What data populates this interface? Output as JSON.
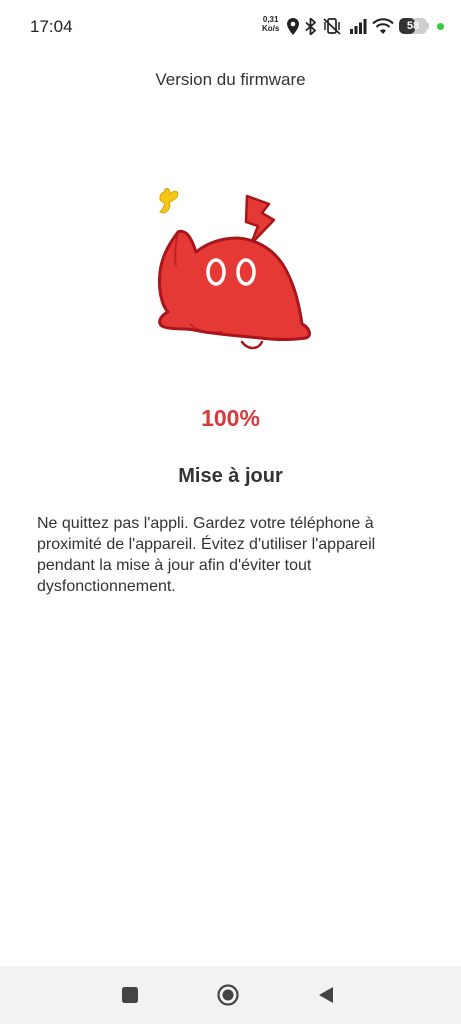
{
  "status_bar": {
    "time": "17:04",
    "net_speed_value": "0,31",
    "net_speed_unit": "Ko/s",
    "battery_level": "58",
    "icons": [
      "location-icon",
      "bluetooth-icon",
      "vibrate-icon",
      "signal-icon",
      "wifi-icon",
      "battery-icon",
      "green-dot-indicator"
    ]
  },
  "header": {
    "title": "Version du firmware"
  },
  "progress": {
    "value_label": "100%",
    "color": "#d63a3a"
  },
  "main": {
    "heading": "Mise à jour",
    "description": "Ne quittez pas l'appli. Gardez votre téléphone à proximité de l'appareil. Évitez d'utiliser l'appareil pendant la mise à jour afin d'éviter tout dysfonctionnement."
  },
  "nav_bar": {
    "buttons": [
      "recents-square-icon",
      "home-circle-icon",
      "back-triangle-icon"
    ]
  },
  "colors": {
    "mascot_red": "#e53935",
    "mascot_outline": "#a8161b",
    "accent_yellow": "#f5c518"
  }
}
